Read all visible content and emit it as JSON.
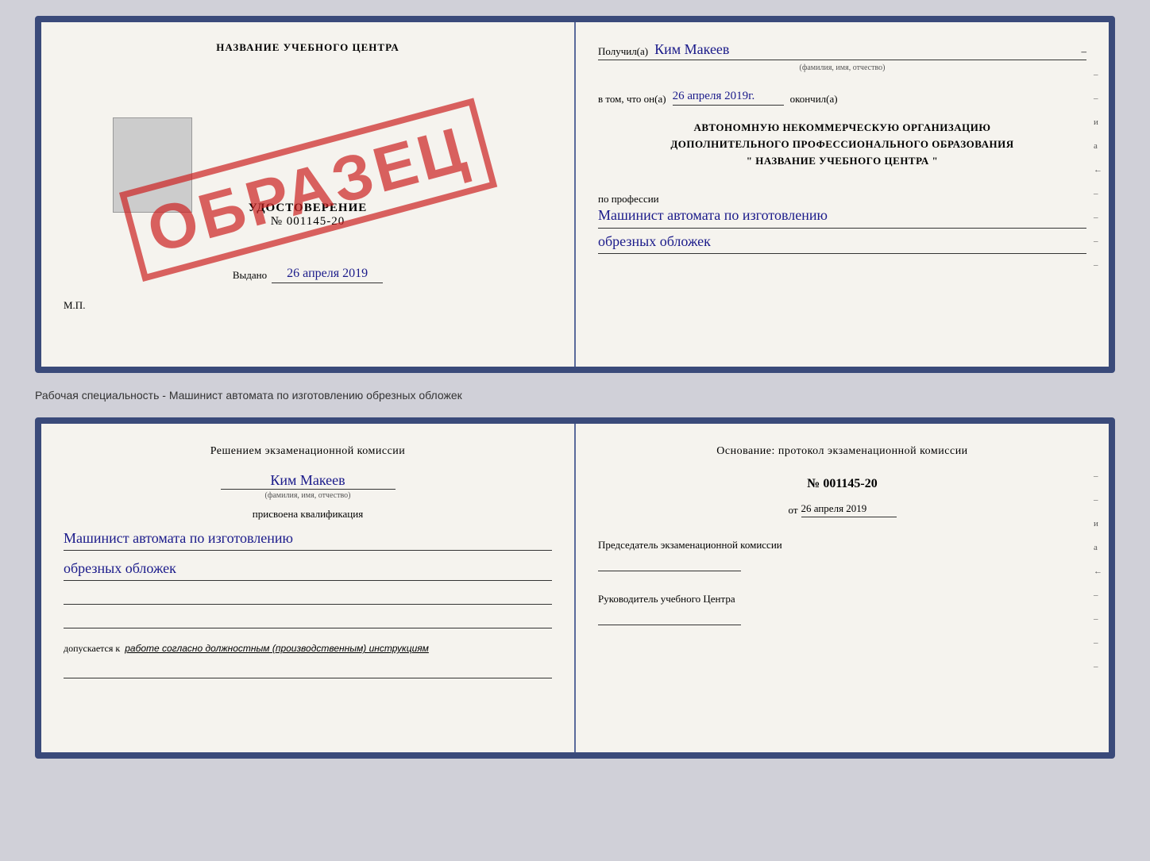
{
  "page": {
    "background": "#d0d0d8"
  },
  "top_doc": {
    "left": {
      "school_name": "НАЗВАНИЕ УЧЕБНОГО ЦЕНТРА",
      "cert_title": "УДОСТОВЕРЕНИЕ",
      "cert_number": "№ 001145-20",
      "issued_label": "Выдано",
      "issued_date": "26 апреля 2019",
      "mp_label": "М.П.",
      "stamp_text": "ОБРАЗЕЦ"
    },
    "right": {
      "received_label": "Получил(а)",
      "recipient_name": "Ким Макеев",
      "name_sub": "(фамилия, имя, отчество)",
      "date_prefix": "в том, что он(а)",
      "date_value": "26 апреля 2019г.",
      "finished_label": "окончил(а)",
      "org_line1": "АВТОНОМНУЮ НЕКОММЕРЧЕСКУЮ ОРГАНИЗАЦИЮ",
      "org_line2": "ДОПОЛНИТЕЛЬНОГО ПРОФЕССИОНАЛЬНОГО ОБРАЗОВАНИЯ",
      "org_line3": "\" НАЗВАНИЕ УЧЕБНОГО ЦЕНТРА \"",
      "profession_label": "по профессии",
      "profession_line1": "Машинист автомата по изготовлению",
      "profession_line2": "обрезных обложек"
    }
  },
  "caption": {
    "text": "Рабочая специальность - Машинист автомата по изготовлению обрезных обложек"
  },
  "bottom_doc": {
    "left": {
      "decision_text": "Решением экзаменационной комиссии",
      "person_name": "Ким Макеев",
      "name_sub": "(фамилия, имя, отчество)",
      "assigned_label": "присвоена квалификация",
      "profession_line1": "Машинист автомата по изготовлению",
      "profession_line2": "обрезных обложек",
      "allow_prefix": "допускается к",
      "allow_value": "работе согласно должностным (производственным) инструкциям"
    },
    "right": {
      "basis_text": "Основание: протокол экзаменационной комиссии",
      "protocol_number": "№ 001145-20",
      "date_prefix": "от",
      "date_value": "26 апреля 2019",
      "chairman_label": "Председатель экзаменационной комиссии",
      "director_label": "Руководитель учебного Центра"
    }
  }
}
